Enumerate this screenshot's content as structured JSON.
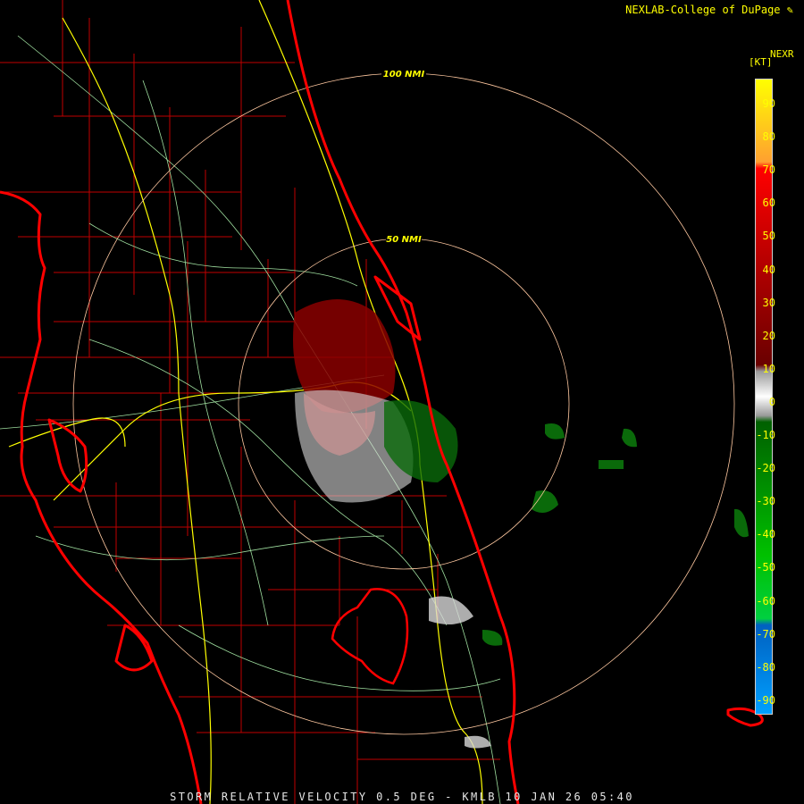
{
  "header": {
    "credit": "NEXLAB-College of DuPage",
    "credit_icon": "pen-icon",
    "product": "NEXR",
    "units": "[KT]"
  },
  "colorbar": {
    "ticks": [
      "90",
      "80",
      "70",
      "60",
      "50",
      "40",
      "30",
      "20",
      "10",
      "0",
      "-10",
      "-20",
      "-30",
      "-40",
      "-50",
      "-60",
      "-70",
      "-80",
      "-90"
    ],
    "stops": [
      "#ffff00",
      "#ffa030",
      "#ff0000",
      "#b00000",
      "#6a0000",
      "#9a9a9a",
      "#ffffff",
      "#006000",
      "#00c000",
      "#00d040",
      "#0060c0",
      "#00a0ff"
    ]
  },
  "range_rings": [
    {
      "label": "100 NMI"
    },
    {
      "label": "50 NMI"
    }
  ],
  "footer": {
    "text": "STORM RELATIVE VELOCITY 0.5 DEG - KMLB 10 JAN 26 05:40"
  },
  "colors": {
    "coast": "#ff0000",
    "county": "#c00000",
    "highway": "#ffff00",
    "road": "#a0e0a0",
    "ring": "#ffc8a0"
  }
}
